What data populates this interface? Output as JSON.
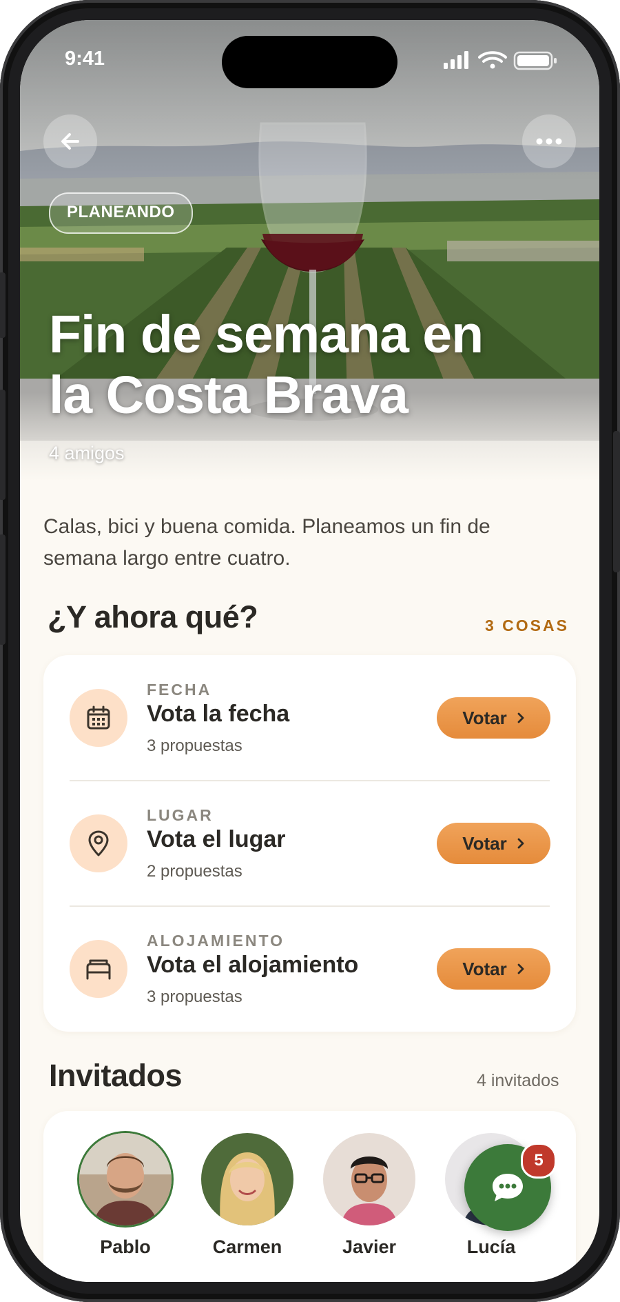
{
  "status_bar": {
    "time": "9:41"
  },
  "hero": {
    "badge": "PLANEANDO",
    "title_line1": "Fin de semana en",
    "title_line2": "la Costa Brava",
    "subtitle": "4 amigos",
    "back_icon": "arrow-left-icon",
    "more_icon": "more-horizontal-icon"
  },
  "description": "Calas, bici y buena comida. Planeamos un fin de semana largo entre cuatro.",
  "next_steps": {
    "title": "¿Y ahora qué?",
    "count_label": "3 COSAS",
    "items": [
      {
        "kicker": "FECHA",
        "title": "Vota la fecha",
        "subtitle": "3 propuestas",
        "button": "Votar",
        "icon": "calendar-icon"
      },
      {
        "kicker": "LUGAR",
        "title": "Vota el lugar",
        "subtitle": "2 propuestas",
        "button": "Votar",
        "icon": "map-pin-icon"
      },
      {
        "kicker": "ALOJAMIENTO",
        "title": "Vota el alojamiento",
        "subtitle": "3 propuestas",
        "button": "Votar",
        "icon": "bed-icon"
      }
    ]
  },
  "guests": {
    "title": "Invitados",
    "count_label": "4 invitados",
    "people": [
      {
        "name": "Pablo"
      },
      {
        "name": "Carmen"
      },
      {
        "name": "Javier"
      },
      {
        "name": "Lucía"
      }
    ]
  },
  "chat": {
    "badge_count": "5",
    "icon": "chat-bubble-icon"
  },
  "colors": {
    "accent": "#e58b3b",
    "accent_text": "#b26a12",
    "icon_bg": "#fde0c8",
    "chat_fab": "#3c7a3a",
    "badge": "#c0392b",
    "page_bg": "#fcf9f3"
  }
}
